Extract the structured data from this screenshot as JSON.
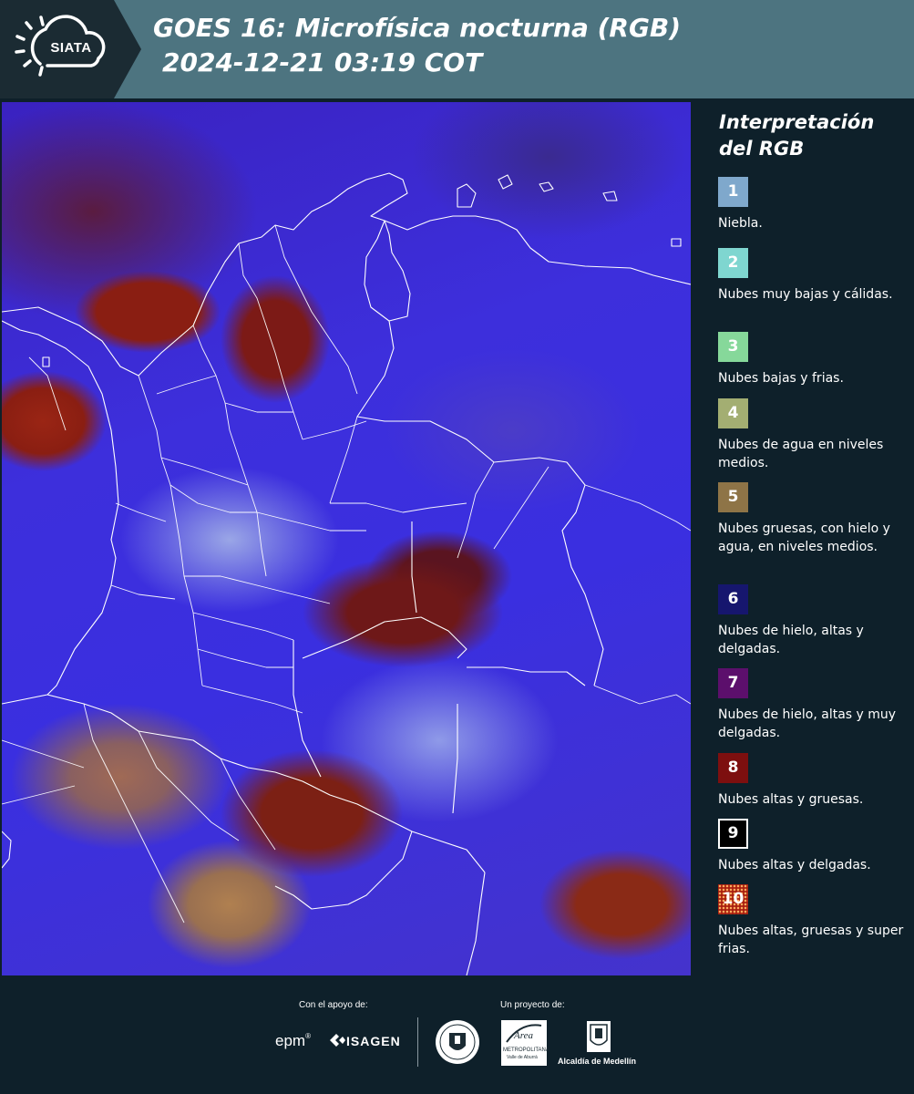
{
  "header": {
    "logo_text": "SIATA",
    "title_line1": "GOES 16: Microfísica nocturna (RGB)",
    "title_line2": "2024-12-21 03:19 COT"
  },
  "map": {
    "icon": "satellite-image"
  },
  "legend": {
    "title_line1": "Interpretación",
    "title_line2": "del RGB",
    "items": [
      {
        "number": "1",
        "color": "#7fa8cc",
        "label": "Niebla."
      },
      {
        "number": "2",
        "color": "#7fd6d0",
        "label": "Nubes muy bajas y cálidas."
      },
      {
        "number": "3",
        "color": "#86d89a",
        "label": "Nubes bajas y frias."
      },
      {
        "number": "4",
        "color": "#a3ae72",
        "label": "Nubes de agua en niveles medios."
      },
      {
        "number": "5",
        "color": "#8e7447",
        "label": "Nubes gruesas, con hielo y agua, en niveles medios."
      },
      {
        "number": "6",
        "color": "#16166e",
        "label": "Nubes de hielo, altas y delgadas."
      },
      {
        "number": "7",
        "color": "#5c0f6c",
        "label": "Nubes de hielo, altas y muy delgadas."
      },
      {
        "number": "8",
        "color": "#7d0f0f",
        "label": "Nubes altas y gruesas."
      },
      {
        "number": "9",
        "color": "#000000",
        "label": "Nubes altas y delgadas."
      },
      {
        "number": "10",
        "color": "#a82010",
        "label": "Nubes altas, gruesas y super frias."
      }
    ]
  },
  "footer": {
    "support_label": "Con el apoyo de:",
    "project_label": "Un proyecto de:",
    "epm": "epm",
    "isagen": "ISAGEN",
    "area_title": "Área",
    "area_sub": "METROPOLITANA",
    "area_sub2": "Valle de Aburrá",
    "alcaldia": "Alcaldía de Medellín"
  }
}
